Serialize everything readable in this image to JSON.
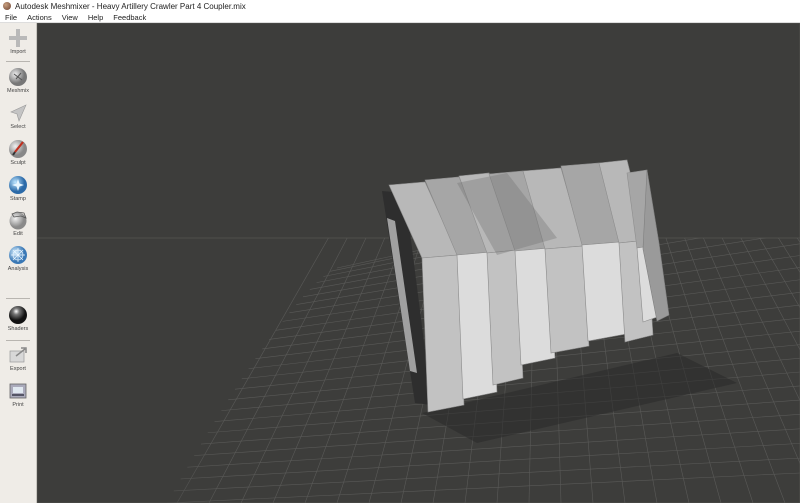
{
  "window": {
    "title": "Autodesk Meshmixer - Heavy Artillery Crawler Part 4 Coupler.mix"
  },
  "menu": [
    "File",
    "Actions",
    "View",
    "Help",
    "Feedback"
  ],
  "tools": [
    {
      "label": "Import",
      "icon": "plus-icon"
    },
    {
      "label": "Meshmix",
      "icon": "meshmix-icon"
    },
    {
      "label": "Select",
      "icon": "select-arrow-icon"
    },
    {
      "label": "Sculpt",
      "icon": "brush-icon"
    },
    {
      "label": "Stamp",
      "icon": "stamp-icon"
    },
    {
      "label": "Edit",
      "icon": "edit-icon"
    },
    {
      "label": "Analysis",
      "icon": "analysis-icon"
    },
    {
      "label": "Shaders",
      "icon": "shaders-icon"
    },
    {
      "label": "Export",
      "icon": "export-icon"
    },
    {
      "label": "Print",
      "icon": "print-icon"
    }
  ],
  "colors": {
    "viewport_bg": "#3d3d3b",
    "grid": "#5a5a58",
    "toolbar_bg": "#efece7",
    "model_light": "#d4d4d4",
    "model_mid": "#a8a8a8",
    "model_dark": "#7a7a7a"
  }
}
